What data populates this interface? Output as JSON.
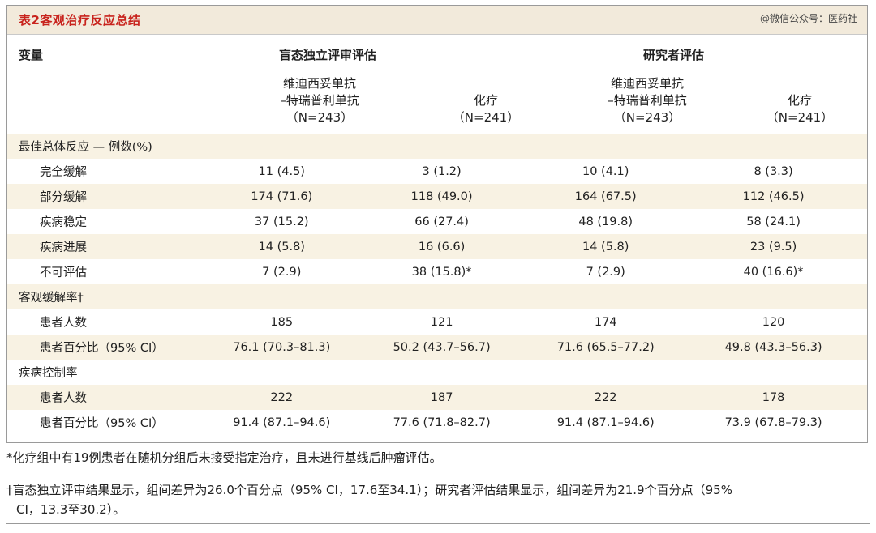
{
  "title": "表2客观治疗反应总结",
  "watermark": "@微信公众号：医药社",
  "headers": {
    "variable": "变量",
    "group_bicr": "盲态独立评审评估",
    "group_inv": "研究者评估",
    "col1": {
      "line1": "维迪西妥单抗",
      "line2": "–特瑞普利单抗",
      "line3": "（N=243）"
    },
    "col2": {
      "line1": "化疗",
      "line2": "（N=241）"
    },
    "col3": {
      "line1": "维迪西妥单抗",
      "line2": "–特瑞普利单抗",
      "line3": "（N=243）"
    },
    "col4": {
      "line1": "化疗",
      "line2": "（N=241）"
    }
  },
  "rows": [
    {
      "label": "最佳总体反应 — 例数(%)",
      "section": true,
      "v": [
        "",
        "",
        "",
        ""
      ]
    },
    {
      "label": "完全缓解",
      "section": false,
      "v": [
        "11 (4.5)",
        "3 (1.2)",
        "10 (4.1)",
        "8 (3.3)"
      ]
    },
    {
      "label": "部分缓解",
      "section": false,
      "v": [
        "174 (71.6)",
        "118 (49.0)",
        "164 (67.5)",
        "112 (46.5)"
      ]
    },
    {
      "label": "疾病稳定",
      "section": false,
      "v": [
        "37 (15.2)",
        "66 (27.4)",
        "48 (19.8)",
        "58 (24.1)"
      ]
    },
    {
      "label": "疾病进展",
      "section": false,
      "v": [
        "14 (5.8)",
        "16 (6.6)",
        "14 (5.8)",
        "23 (9.5)"
      ]
    },
    {
      "label": "不可评估",
      "section": false,
      "v": [
        "7 (2.9)",
        "38 (15.8)*",
        "7 (2.9)",
        "40 (16.6)*"
      ]
    },
    {
      "label": "客观缓解率†",
      "section": true,
      "v": [
        "",
        "",
        "",
        ""
      ]
    },
    {
      "label": "患者人数",
      "section": false,
      "v": [
        "185",
        "121",
        "174",
        "120"
      ]
    },
    {
      "label": "患者百分比（95% CI）",
      "section": false,
      "v": [
        "76.1 (70.3–81.3)",
        "50.2 (43.7–56.7)",
        "71.6 (65.5–77.2)",
        "49.8 (43.3–56.3)"
      ]
    },
    {
      "label": "疾病控制率",
      "section": true,
      "v": [
        "",
        "",
        "",
        ""
      ]
    },
    {
      "label": "患者人数",
      "section": false,
      "v": [
        "222",
        "187",
        "222",
        "178"
      ]
    },
    {
      "label": "患者百分比（95% CI）",
      "section": false,
      "v": [
        "91.4 (87.1–94.6)",
        "77.6 (71.8–82.7)",
        "91.4 (87.1–94.6)",
        "73.9 (67.8–79.3)"
      ]
    }
  ],
  "footnotes": {
    "star": "*化疗组中有19例患者在随机分组后未接受指定治疗，且未进行基线后肿瘤评估。",
    "dagger_line1": "†盲态独立评审结果显示，组间差异为26.0个百分点（95% CI，17.6至34.1）；研究者评估结果显示，组间差异为21.9个百分点（95%",
    "dagger_line2": "CI，13.3至30.2）。"
  },
  "colors": {
    "title_red": "#c8231d",
    "header_bg": "#f2eadb",
    "shade_bg": "#f8f2e3"
  }
}
